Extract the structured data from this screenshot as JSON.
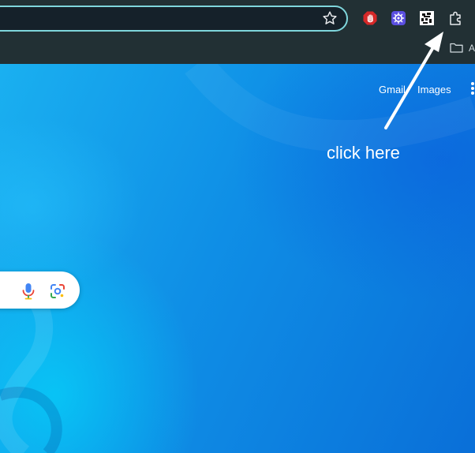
{
  "browser": {
    "extensions": [
      "stop-hand-icon",
      "gear-badge-icon",
      "pixel-art-icon",
      "extensions-puzzle-icon"
    ],
    "bookmarks_bar": {
      "visible_folder_label": "A"
    }
  },
  "google": {
    "header_links": {
      "gmail": "Gmail",
      "images": "Images"
    }
  },
  "annotation": {
    "text": "click here"
  },
  "colors": {
    "toolbar_bg": "#223034",
    "omnibox_border": "#7fd6dc",
    "page_bg": "#0f8fe6",
    "annotation_arrow": "#ffffff"
  }
}
